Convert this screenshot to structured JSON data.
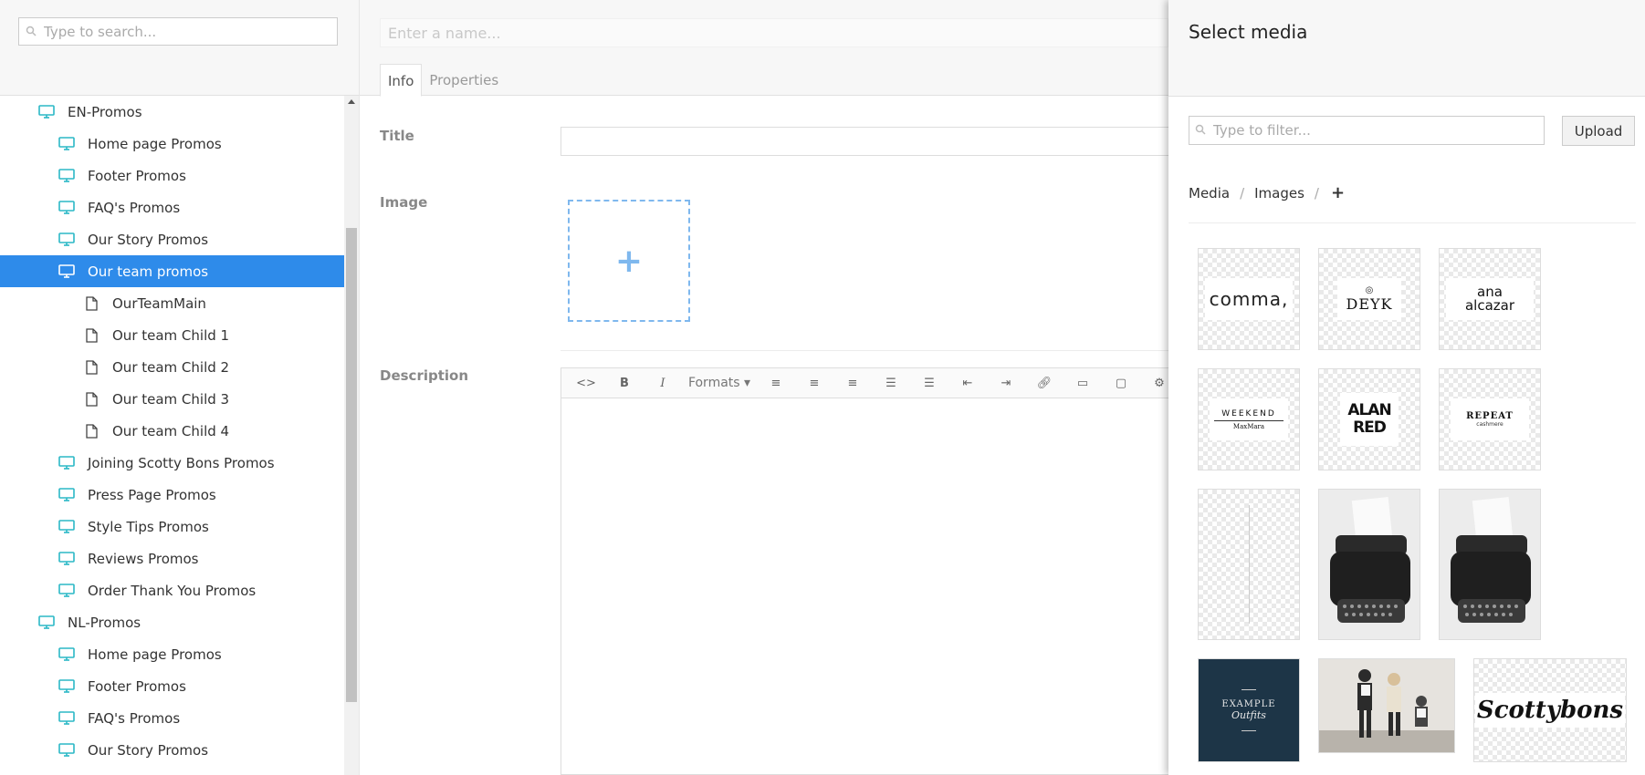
{
  "tree": {
    "search_placeholder": "Type to search...",
    "items": [
      {
        "label": "EN-Promos",
        "level": 0,
        "type": "folder",
        "selected": false
      },
      {
        "label": "Home page Promos",
        "level": 1,
        "type": "folder",
        "selected": false
      },
      {
        "label": "Footer Promos",
        "level": 1,
        "type": "folder",
        "selected": false
      },
      {
        "label": "FAQ's Promos",
        "level": 1,
        "type": "folder",
        "selected": false
      },
      {
        "label": "Our Story Promos",
        "level": 1,
        "type": "folder",
        "selected": false
      },
      {
        "label": "Our team promos",
        "level": 1,
        "type": "folder",
        "selected": true
      },
      {
        "label": "OurTeamMain",
        "level": 2,
        "type": "document",
        "selected": false
      },
      {
        "label": "Our team Child 1",
        "level": 2,
        "type": "document",
        "selected": false
      },
      {
        "label": "Our team Child 2",
        "level": 2,
        "type": "document",
        "selected": false
      },
      {
        "label": "Our team Child 3",
        "level": 2,
        "type": "document",
        "selected": false
      },
      {
        "label": "Our team Child 4",
        "level": 2,
        "type": "document",
        "selected": false
      },
      {
        "label": "Joining Scotty Bons Promos",
        "level": 1,
        "type": "folder",
        "selected": false
      },
      {
        "label": "Press Page Promos",
        "level": 1,
        "type": "folder",
        "selected": false
      },
      {
        "label": "Style Tips Promos",
        "level": 1,
        "type": "folder",
        "selected": false
      },
      {
        "label": "Reviews Promos",
        "level": 1,
        "type": "folder",
        "selected": false
      },
      {
        "label": "Order Thank You Promos",
        "level": 1,
        "type": "folder",
        "selected": false
      },
      {
        "label": "NL-Promos",
        "level": 0,
        "type": "folder",
        "selected": false
      },
      {
        "label": "Home page Promos",
        "level": 1,
        "type": "folder",
        "selected": false
      },
      {
        "label": "Footer Promos",
        "level": 1,
        "type": "folder",
        "selected": false
      },
      {
        "label": "FAQ's Promos",
        "level": 1,
        "type": "folder",
        "selected": false
      },
      {
        "label": "Our Story Promos",
        "level": 1,
        "type": "folder",
        "selected": false
      }
    ]
  },
  "editor": {
    "name_placeholder": "Enter a name...",
    "tabs": [
      "Info",
      "Properties"
    ],
    "active_tab": "Info",
    "labels": {
      "title": "Title",
      "image": "Image",
      "description": "Description"
    },
    "image_add_symbol": "+",
    "rte_toolbar": {
      "formats_label": "Formats"
    }
  },
  "media_picker": {
    "title": "Select media",
    "filter_placeholder": "Type to filter...",
    "upload_label": "Upload",
    "breadcrumb": [
      "Media",
      "Images"
    ],
    "breadcrumb_add": "+",
    "thumbnails": [
      {
        "name": "comma",
        "text": "comma,"
      },
      {
        "name": "deyk",
        "text": "DEYK"
      },
      {
        "name": "ana-alcazar",
        "text": "ana alcazar"
      },
      {
        "name": "weekend-maxmara",
        "text": "WEEKEND",
        "sub": "MaxMara"
      },
      {
        "name": "alan-red",
        "text": "ALAN RED"
      },
      {
        "name": "repeat-cashmere",
        "text": "REPEAT",
        "sub": "cashmere"
      },
      {
        "name": "blank-line",
        "text": ""
      },
      {
        "name": "typewriter-1",
        "text": ""
      },
      {
        "name": "typewriter-2",
        "text": ""
      },
      {
        "name": "example-outfits",
        "text": "EXAMPLE",
        "sub": "Outfits"
      },
      {
        "name": "people-escalator",
        "text": ""
      },
      {
        "name": "scottybons",
        "text": "Scottybons"
      }
    ]
  },
  "colors": {
    "selected": "#2e8bea",
    "folder_icon": "#2bb8c6",
    "accent_dashed": "#7fb8ee"
  }
}
